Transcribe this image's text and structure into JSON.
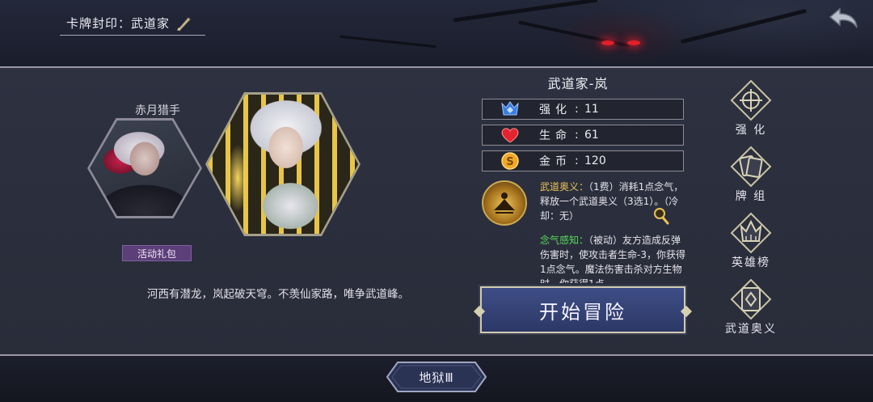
{
  "header": {
    "title": "卡牌封印：武道家"
  },
  "left": {
    "secondary_character_name": "赤月猎手",
    "pack_badge": "活动礼包",
    "flavor_text": "河西有潜龙，岚起破天穹。不羡仙家路，唯争武道峰。"
  },
  "character": {
    "name": "武道家-岚",
    "stats": [
      {
        "label": "强化",
        "value": "11",
        "icon": "enhance-icon"
      },
      {
        "label": "生命",
        "value": "61",
        "icon": "heart-icon"
      },
      {
        "label": "金币",
        "value": "120",
        "icon": "coin-icon"
      }
    ],
    "skills": [
      {
        "name": "武道奥义：",
        "text": "（1费）消耗1点念气，释放一个武道奥义（3选1）。（冷却：无）",
        "color": "#e8c35a"
      },
      {
        "name": "念气感知：",
        "text": "（被动）友方造成反弹伤害时，使攻击者生命-3，你获得1点念气。魔法伤害击杀对方生物时，你获得1点",
        "color": "#58d85c"
      }
    ],
    "start_button": "开始冒险"
  },
  "side_menu": [
    {
      "label": "强 化",
      "icon": "enhance-menu-icon"
    },
    {
      "label": "牌 组",
      "icon": "deck-icon"
    },
    {
      "label": "英雄榜",
      "icon": "leaderboard-icon"
    },
    {
      "label": "武道奥义",
      "icon": "martial-secret-icon"
    }
  ],
  "difficulty": {
    "label": "地狱Ⅲ"
  },
  "colors": {
    "panel": "#2d3140",
    "accent_gold": "#e8c35a",
    "accent_green": "#58d85c",
    "button_blue": "#3e4e86",
    "badge_purple": "#5c3f78"
  }
}
